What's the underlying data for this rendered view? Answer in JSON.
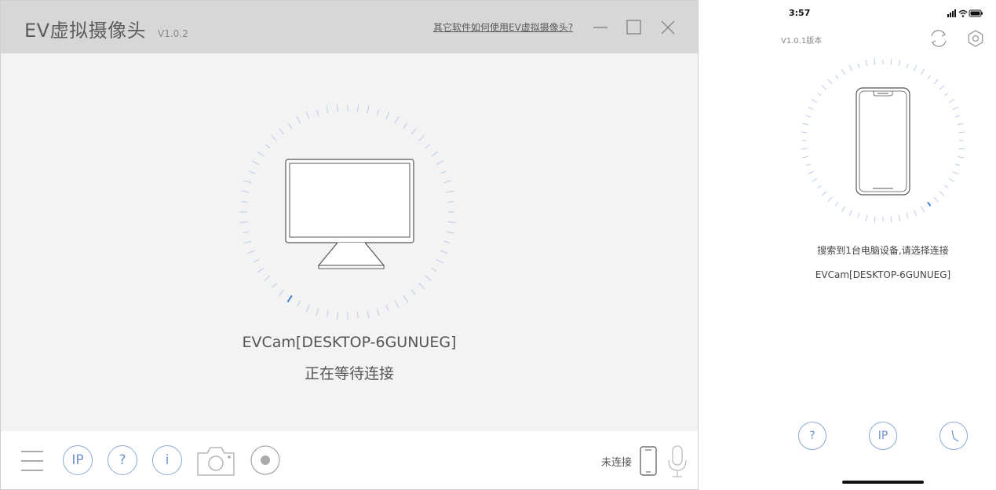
{
  "desktop": {
    "title": "EV虚拟摄像头",
    "version": "V1.0.2",
    "help_link": "其它软件如何使用EV虚拟摄像头?",
    "device_name": "EVCam[DESKTOP-6GUNUEG]",
    "status": "正在等待连接",
    "toolbar": {
      "ip_label": "IP",
      "help_label": "?",
      "info_label": "i",
      "connection_status": "未连接"
    },
    "colors": {
      "accent": "#6f93cf",
      "titlebar": "#d7d7d7",
      "background": "#f3f3f3"
    }
  },
  "phone": {
    "time": "3:57",
    "version": "V1.0.1版本",
    "found_text": "搜索到1台电脑设备,请选择连接",
    "device_name": "EVCam[DESKTOP-6GUNUEG]",
    "buttons": {
      "help_label": "?",
      "ip_label": "IP"
    }
  },
  "icons": [
    "menu-icon",
    "camera-icon",
    "record-icon",
    "phone-icon",
    "microphone-icon",
    "refresh-icon",
    "settings-icon",
    "timer-icon",
    "monitor-icon",
    "minimize-icon",
    "maximize-icon",
    "close-icon"
  ]
}
